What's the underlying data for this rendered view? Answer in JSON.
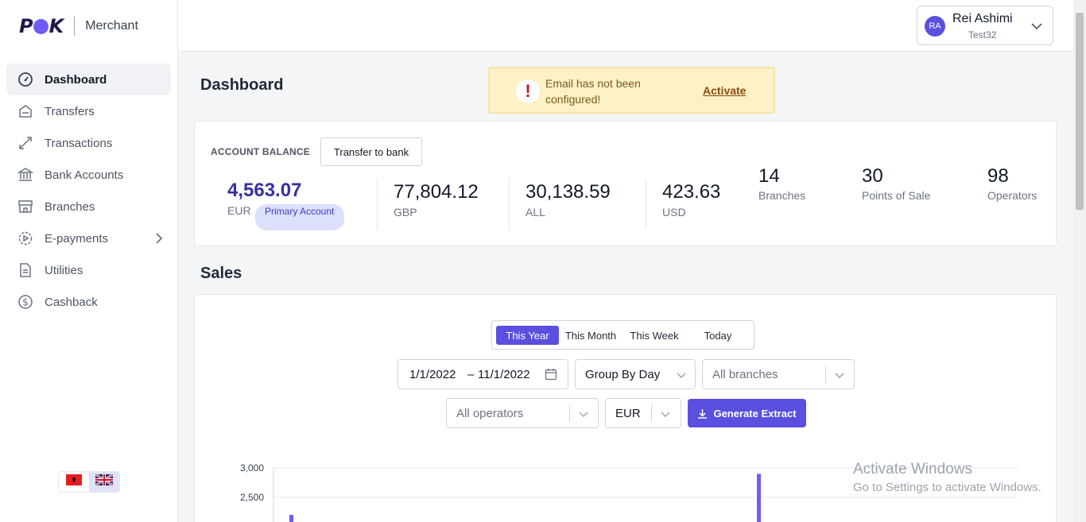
{
  "brand": {
    "logo_text": "POK",
    "product": "Merchant"
  },
  "sidebar": {
    "items": [
      {
        "label": "Dashboard",
        "icon": "gauge-icon",
        "active": true
      },
      {
        "label": "Transfers",
        "icon": "transfer-icon"
      },
      {
        "label": "Transactions",
        "icon": "arrows-icon"
      },
      {
        "label": "Bank Accounts",
        "icon": "bank-icon"
      },
      {
        "label": "Branches",
        "icon": "store-icon"
      },
      {
        "label": "E-payments",
        "icon": "epayment-icon",
        "has_submenu": true
      },
      {
        "label": "Utilities",
        "icon": "document-icon"
      },
      {
        "label": "Cashback",
        "icon": "dollar-icon"
      }
    ],
    "languages": [
      "albanian-flag-icon",
      "uk-flag-icon"
    ],
    "selected_language": "uk-flag-icon"
  },
  "header": {
    "user": {
      "initials": "RA",
      "name": "Rei Ashimi",
      "subtitle": "Test32"
    }
  },
  "page": {
    "title": "Dashboard"
  },
  "alert": {
    "message": "Email has not been configured!",
    "action": "Activate"
  },
  "balance": {
    "label": "ACCOUNT BALANCE",
    "transfer_button": "Transfer to bank",
    "currencies": [
      {
        "value": "4,563.07",
        "code": "EUR",
        "primary": true,
        "badge": "Primary Account"
      },
      {
        "value": "77,804.12",
        "code": "GBP"
      },
      {
        "value": "30,138.59",
        "code": "ALL"
      },
      {
        "value": "423.63",
        "code": "USD"
      }
    ],
    "stats": [
      {
        "value": "14",
        "label": "Branches"
      },
      {
        "value": "30",
        "label": "Points of Sale"
      },
      {
        "value": "98",
        "label": "Operators"
      }
    ]
  },
  "sales": {
    "title": "Sales",
    "periods": [
      "This Year",
      "This Month",
      "This Week",
      "Today"
    ],
    "active_period": "This Year",
    "date_from": "1/1/2022",
    "date_to": "11/1/2022",
    "group_by": "Group By Day",
    "branches_placeholder": "All branches",
    "operators_placeholder": "All operators",
    "currency": "EUR",
    "generate_button": "Generate Extract"
  },
  "chart_data": {
    "type": "bar",
    "y_ticks": [
      "3,000",
      "2,500"
    ],
    "ylim_visible": [
      2400,
      3000
    ],
    "visible_bars": [
      {
        "position": "start",
        "value": 2200
      },
      {
        "position": "middle",
        "value": 2900
      }
    ]
  },
  "watermark": {
    "line1": "Activate Windows",
    "line2": "Go to Settings to activate Windows."
  },
  "colors": {
    "accent": "#5b4fe0",
    "alert_bg": "#fcf1c7",
    "primary_value": "#3730a3"
  }
}
